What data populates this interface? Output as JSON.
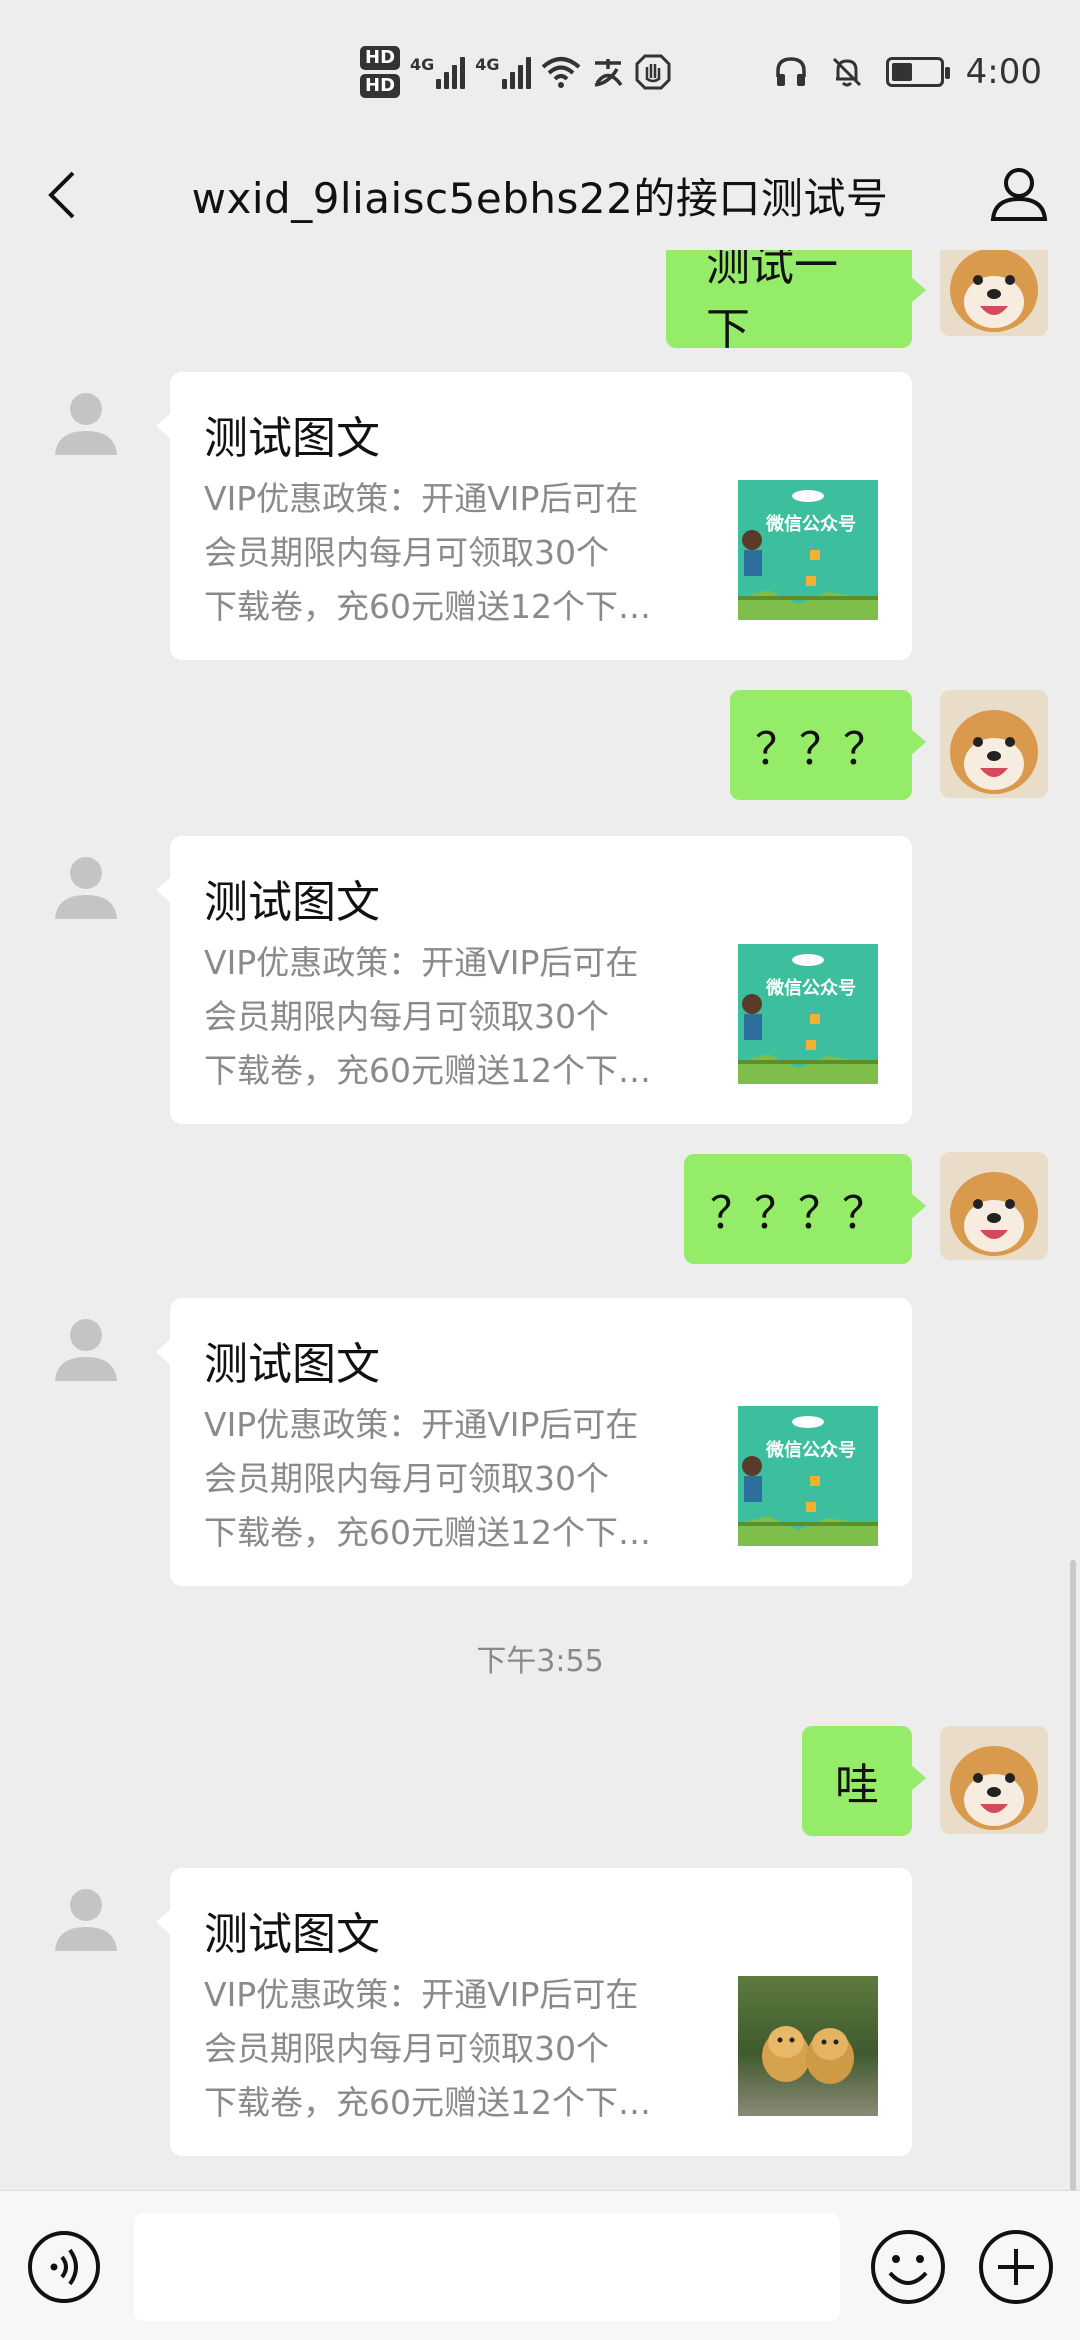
{
  "status_bar": {
    "hd1": "HD",
    "hd2": "HD",
    "net1": "4G",
    "net2": "4G",
    "time": "4:00",
    "battery_level": 0.45
  },
  "header": {
    "title": "wxid_9liaisc5ebhs22的接口测试号",
    "back_icon": "chevron-left-icon",
    "profile_icon": "person-icon"
  },
  "messages": {
    "out1": "测试一下",
    "card1": {
      "title": "测试图文",
      "desc": [
        "VIP优惠政策：开通VIP后可在",
        "会员期限内每月可领取30个",
        "下载卷，充60元赠送12个下…"
      ]
    },
    "out2": "？？？",
    "card2": {
      "title": "测试图文",
      "desc": [
        "VIP优惠政策：开通VIP后可在",
        "会员期限内每月可领取30个",
        "下载卷，充60元赠送12个下…"
      ]
    },
    "out3": "？？？？",
    "card3": {
      "title": "测试图文",
      "desc": [
        "VIP优惠政策：开通VIP后可在",
        "会员期限内每月可领取30个",
        "下载卷，充60元赠送12个下…"
      ]
    },
    "timestamp": "下午3:55",
    "out4": "哇",
    "card4": {
      "title": "测试图文",
      "desc": [
        "VIP优惠政策：开通VIP后可在",
        "会员期限内每月可领取30个",
        "下载卷，充60元赠送12个下…"
      ]
    }
  },
  "thumb_text": "微信公众号",
  "input_bar": {
    "placeholder": "",
    "voice_icon": "voice-icon",
    "emoji_icon": "emoji-icon",
    "plus_icon": "plus-icon"
  },
  "colors": {
    "background": "#ededed",
    "outgoing_bubble": "#95ec69",
    "incoming_card": "#ffffff",
    "secondary_text": "#8a8a8a"
  }
}
